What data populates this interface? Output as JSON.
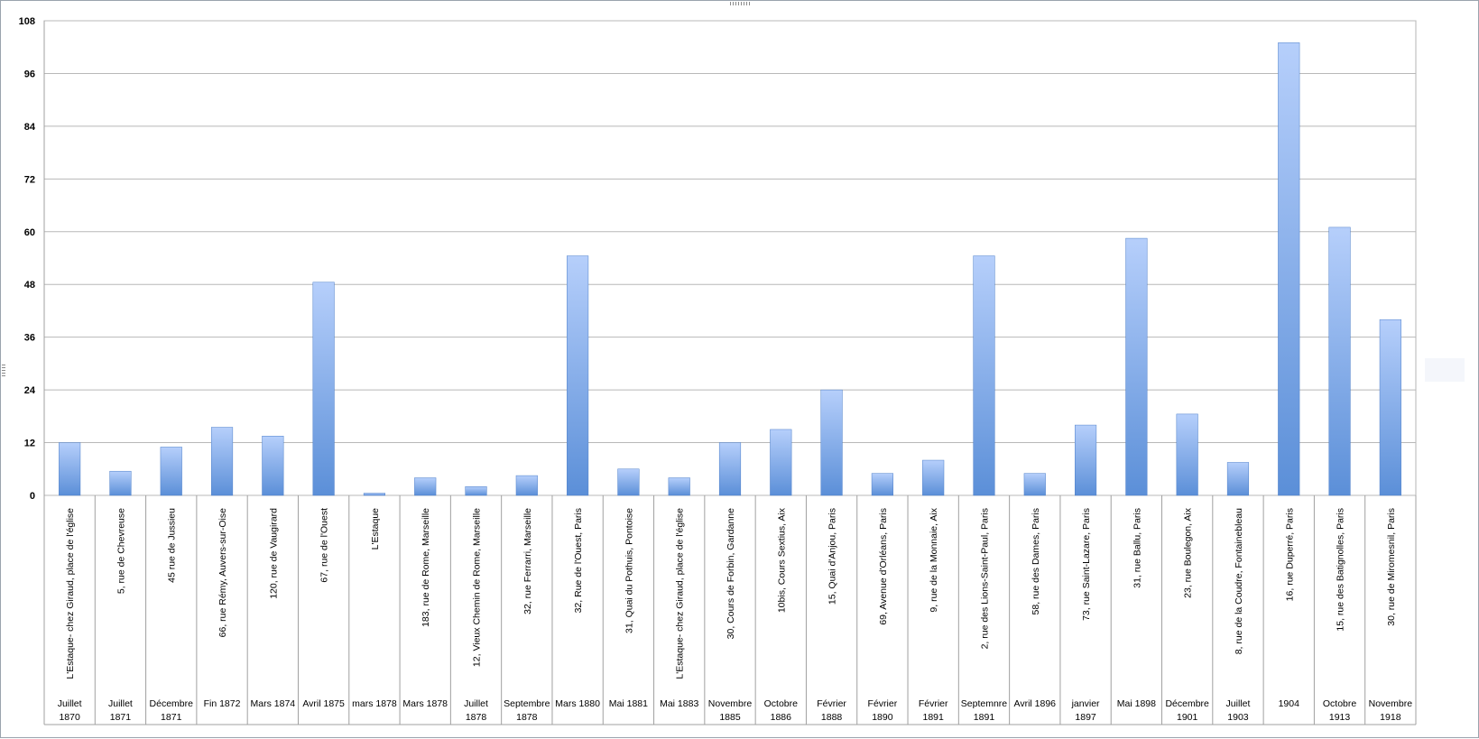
{
  "chart_data": {
    "type": "bar",
    "title": "",
    "xlabel": "",
    "ylabel": "",
    "ylim": [
      0,
      108
    ],
    "yticks": [
      "108",
      "96",
      "84",
      "72",
      "60",
      "48",
      "36",
      "24",
      "12",
      "0"
    ],
    "grid": true,
    "legend": "none",
    "bar_color_top": "#b6cffb",
    "bar_color_bottom": "#5b8fd8",
    "categories": [
      {
        "address": "L'Estaque- chez Giraud, place de l'église",
        "date": "Juillet 1870"
      },
      {
        "address": "5, rue de Chevreuse",
        "date": "Juillet 1871"
      },
      {
        "address": "45 rue de Jussieu",
        "date": "Décembre 1871"
      },
      {
        "address": "66, rue Rémy, Auvers-sur-Oise",
        "date": "Fin 1872"
      },
      {
        "address": "120, rue de Vaugirard",
        "date": "Mars 1874"
      },
      {
        "address": "67, rue de l'Ouest",
        "date": "Avril 1875"
      },
      {
        "address": "L'Estaque",
        "date": "mars 1878"
      },
      {
        "address": "183, rue de Rome, Marseille",
        "date": "Mars 1878"
      },
      {
        "address": "12, Vieux Chemin de Rome, Marseille",
        "date": "Juillet 1878"
      },
      {
        "address": "32, rue Ferrarri, Marseille",
        "date": "Septembre 1878"
      },
      {
        "address": "32, Rue de l'Ouest, Paris",
        "date": "Mars 1880"
      },
      {
        "address": "31, Quai du Pothuis, Pontoise",
        "date": "Mai 1881"
      },
      {
        "address": "L'Estaque- chez Giraud, place de l'église",
        "date": "Mai 1883"
      },
      {
        "address": "30, Cours de Forbin, Gardanne",
        "date": "Novembre 1885"
      },
      {
        "address": "10bis, Cours Sextius, Aix",
        "date": "Octobre 1886"
      },
      {
        "address": "15, Quai d'Anjou, Paris",
        "date": "Février 1888"
      },
      {
        "address": "69, Avenue d'Orléans, Paris",
        "date": "Février 1890"
      },
      {
        "address": "9, rue de la Monnaie, Aix",
        "date": "Février 1891"
      },
      {
        "address": "2, rue des Lions-Saint-Paul, Paris",
        "date": "Septemnre 1891"
      },
      {
        "address": "58, rue des Dames, Paris",
        "date": "Avril 1896"
      },
      {
        "address": "73, rue Saint-Lazare, Paris",
        "date": "janvier 1897"
      },
      {
        "address": "31, rue Ballu, Paris",
        "date": "Mai 1898"
      },
      {
        "address": "23, rue Boulegon, Aix",
        "date": "Décembre 1901"
      },
      {
        "address": "8, rue de la Coudre, Fontainebleau",
        "date": "Juillet 1903"
      },
      {
        "address": "16, rue Duperré, Paris",
        "date": "1904"
      },
      {
        "address": "15, rue des Batignolles, Paris",
        "date": "Octobre 1913"
      },
      {
        "address": "30, rue de Miromesnil, Paris",
        "date": "Novembre 1918"
      }
    ],
    "values": [
      12,
      5.5,
      11,
      15.5,
      13.5,
      48.5,
      0.5,
      4,
      2,
      4.5,
      54.5,
      6,
      4,
      12,
      15,
      24,
      5,
      8,
      54.5,
      5,
      16,
      58.5,
      18.5,
      7.5,
      103,
      61,
      40
    ]
  }
}
